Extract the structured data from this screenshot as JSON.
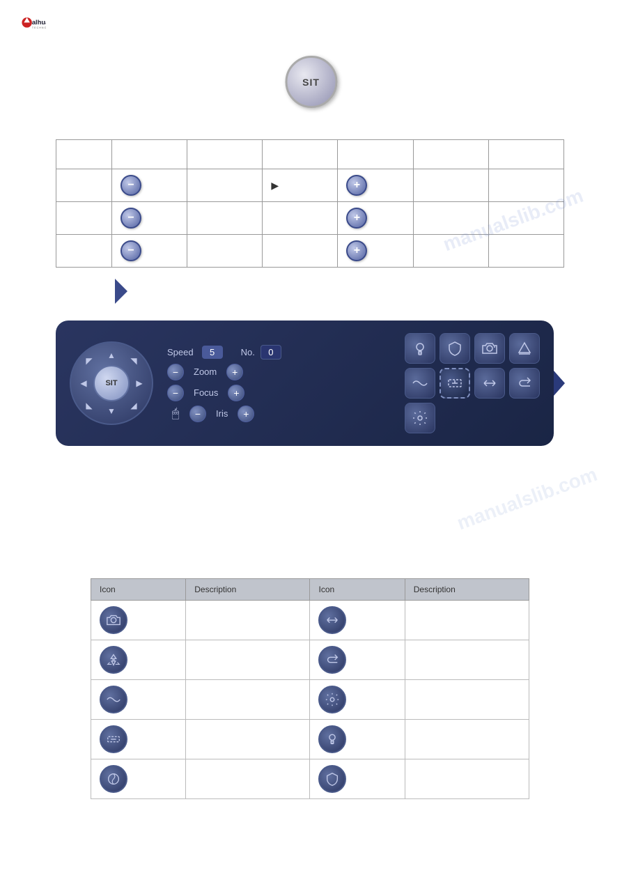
{
  "logo": {
    "text": "alhua",
    "subtext": "TECHNOLOGY"
  },
  "sit_button": {
    "label": "SIT"
  },
  "table1": {
    "headers": [
      "",
      "",
      "",
      "",
      "",
      "",
      ""
    ],
    "rows": [
      {
        "col1": "",
        "col2": "minus",
        "col3": "",
        "col4": "play",
        "col5": "plus",
        "col6": "",
        "col7": ""
      },
      {
        "col1": "",
        "col2": "minus",
        "col3": "",
        "col4": "",
        "col5": "plus",
        "col6": "",
        "col7": ""
      },
      {
        "col1": "",
        "col2": "minus",
        "col3": "",
        "col4": "",
        "col5": "plus",
        "col6": "",
        "col7": ""
      }
    ]
  },
  "ptz_panel": {
    "sit_label": "SIT",
    "speed_label": "Speed",
    "speed_value": "5",
    "no_label": "No.",
    "no_value": "0",
    "zoom_label": "Zoom",
    "focus_label": "Focus",
    "iris_label": "Iris"
  },
  "table2": {
    "headers": [
      "Icon",
      "Description",
      "Icon",
      "Description"
    ],
    "rows": [
      {
        "icon1": "camera",
        "desc1": "",
        "icon2": "flip-h",
        "desc2": ""
      },
      {
        "icon1": "recycle",
        "desc1": "",
        "icon2": "return",
        "desc2": ""
      },
      {
        "icon1": "wave",
        "desc1": "",
        "icon2": "gear",
        "desc2": ""
      },
      {
        "icon1": "wiper",
        "desc1": "",
        "icon2": "bulb",
        "desc2": ""
      },
      {
        "icon1": "tour",
        "desc1": "",
        "icon2": "shield",
        "desc2": ""
      }
    ]
  },
  "watermark": "manualslib.com",
  "watermark2": "manualslib.com"
}
